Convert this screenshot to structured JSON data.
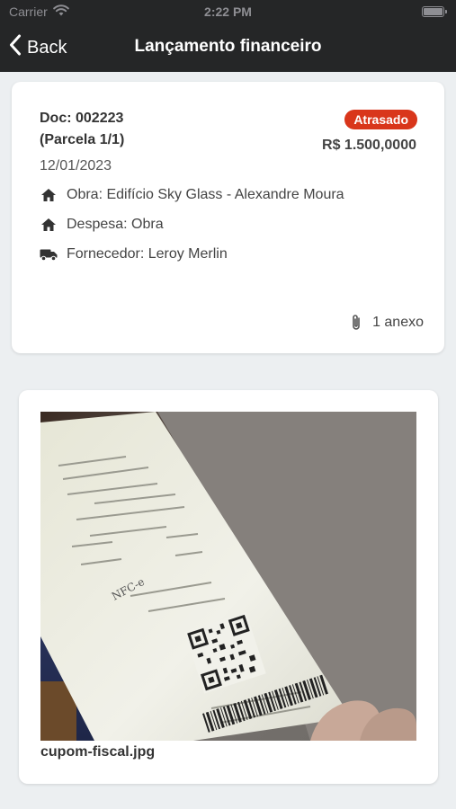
{
  "status_bar": {
    "carrier": "Carrier",
    "time": "2:22 PM",
    "icons": [
      "wifi-icon",
      "battery-icon"
    ]
  },
  "nav": {
    "back_label": "Back",
    "title": "Lançamento financeiro"
  },
  "document": {
    "doc_number": "Doc: 002223",
    "parcela": "(Parcela 1/1)",
    "date": "12/01/2023",
    "status": "Atrasado",
    "status_color": "#d9361b",
    "amount": "R$ 1.500,0000",
    "rows": [
      {
        "icon": "home-icon",
        "text": "Obra: Edifício Sky Glass - Alexandre Moura"
      },
      {
        "icon": "home-icon",
        "text": "Despesa: Obra"
      },
      {
        "icon": "truck-icon",
        "text": "Fornecedor: Leroy Merlin"
      }
    ],
    "attachments_label": "1 anexo"
  },
  "attachment": {
    "file_name": "cupom-fiscal.jpg",
    "receipt_text": "NFC-e"
  },
  "colors": {
    "topbar": "#252627",
    "background": "#eceff1",
    "badge": "#d9361b"
  }
}
